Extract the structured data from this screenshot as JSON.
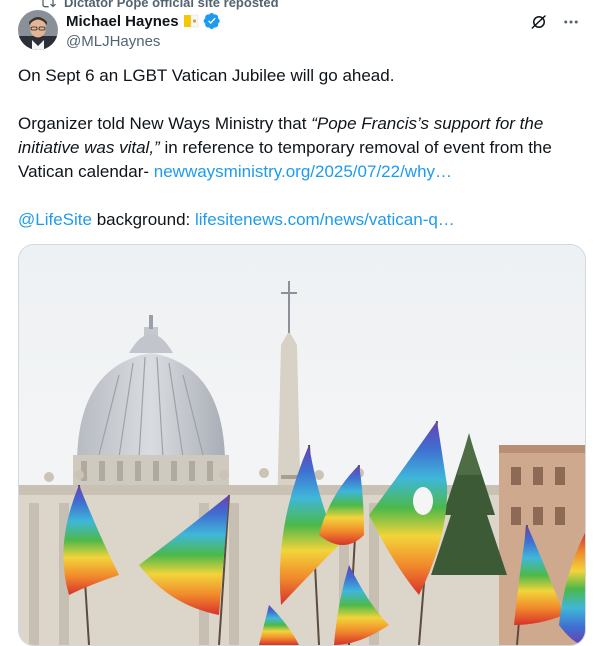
{
  "repost": {
    "icon": "repost-icon",
    "text": "Dictator Pope official site reposted"
  },
  "author": {
    "name": "Michael Haynes",
    "flag_icon": "vatican-flag-icon",
    "verified_icon": "verified-badge-icon",
    "handle": "@MLJHaynes"
  },
  "actions": {
    "grok_icon": "grok-icon",
    "more_icon": "more-icon"
  },
  "tweet": {
    "line1": "On Sept 6 an LGBT Vatican Jubilee will go ahead.",
    "p2_lead": "Organizer told New Ways Ministry that ",
    "p2_quote": "“Pope Francis’s support for the initiative was vital,”",
    "p2_rest": " in reference to temporary removal of event from the Vatican calendar- ",
    "p2_link": "newwaysministry.org/2025/07/22/why…",
    "mention": "@LifeSite",
    "p3_mid": " background: ",
    "p3_link": "lifesitenews.com/news/vatican-q…"
  },
  "media": {
    "subject": "photo",
    "colors": {
      "sky": "#f2f4f6",
      "dome": "#c9ccd1",
      "stone": "#d8d2c6",
      "tree": "#3d5a36"
    }
  }
}
